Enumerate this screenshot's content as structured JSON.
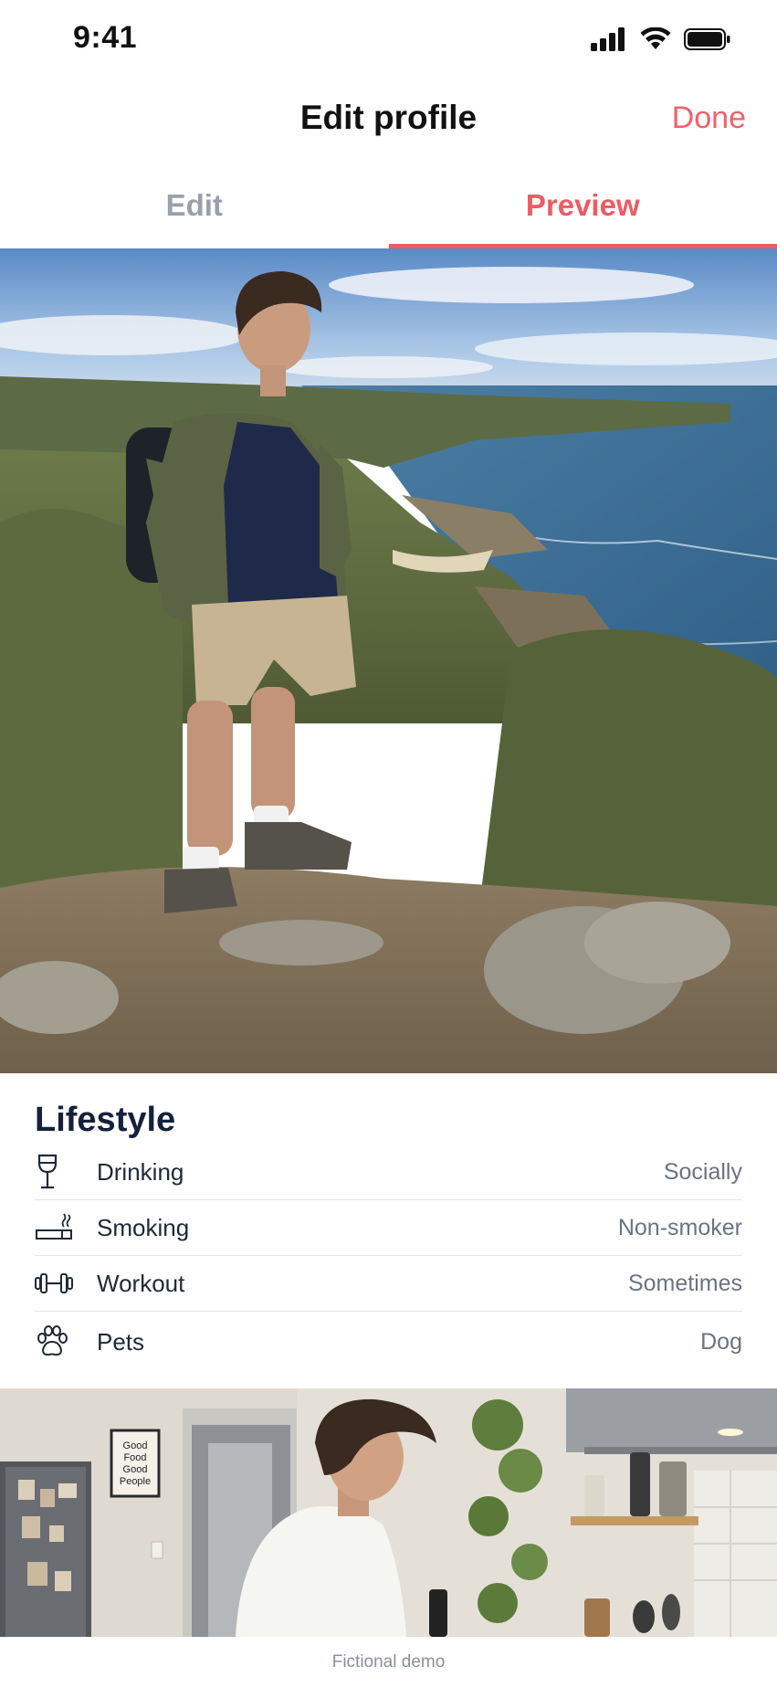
{
  "status_bar": {
    "time": "9:41",
    "icons": [
      "cellular-signal-icon",
      "wifi-icon",
      "battery-icon"
    ]
  },
  "header": {
    "title": "Edit profile",
    "done_label": "Done"
  },
  "tabs": [
    {
      "label": "Edit",
      "active": false
    },
    {
      "label": "Preview",
      "active": true
    }
  ],
  "photos": [
    {
      "subject": "man with backpack on coastal cliff"
    },
    {
      "subject": "man in kitchen",
      "poster_text": [
        "Good",
        "Food",
        "Good",
        "People"
      ]
    }
  ],
  "lifestyle": {
    "title": "Lifestyle",
    "items": [
      {
        "label": "Drinking",
        "value": "Socially",
        "icon": "wine-glass-icon"
      },
      {
        "label": "Smoking",
        "value": "Non-smoker",
        "icon": "cigarette-icon"
      },
      {
        "label": "Workout",
        "value": "Sometimes",
        "icon": "dumbbell-icon"
      },
      {
        "label": "Pets",
        "value": "Dog",
        "icon": "paw-icon"
      }
    ]
  },
  "footer": {
    "text": "Fictional demo"
  },
  "colors": {
    "accent": "#ef5b62",
    "title": "#15213b",
    "muted": "#6b7280"
  }
}
